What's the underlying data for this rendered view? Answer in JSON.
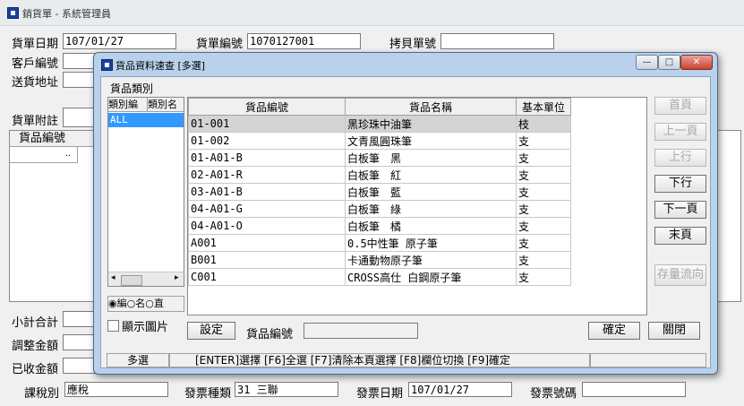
{
  "window": {
    "title": "銷貨單 - 系統管理員"
  },
  "form": {
    "order_date_label": "貨單日期",
    "order_date_value": "107/01/27",
    "order_no_label": "貨單編號",
    "order_no_value": "1070127001",
    "copy_no_label": "拷貝單號",
    "copy_no_value": "",
    "customer_label": "客戶編號",
    "address_label": "送貨地址",
    "note_label": "貨單附註",
    "item_code_header": "貨品編號",
    "subtotal_label": "小計合計",
    "adjust_label": "調整金額",
    "received_label": "已收金額",
    "tax_label": "課稅別",
    "tax_value": "應稅",
    "invoice_type_label": "發票種類",
    "invoice_type_value": "31 三聯",
    "invoice_date_label": "發票日期",
    "invoice_date_value": "107/01/27",
    "invoice_no_label": "發票號碼",
    "invoice_no_value": ""
  },
  "dialog": {
    "title": "貨品資料速查 [多選]",
    "category_label": "貨品類別",
    "category_headers": [
      "類別編",
      "類別名"
    ],
    "categories": [
      {
        "code": "ALL",
        "name": ""
      }
    ],
    "radio_options": [
      "編",
      "名",
      "直"
    ],
    "show_image_label": "顯示圖片",
    "columns": [
      "貨品編號",
      "貨品名稱",
      "基本單位"
    ],
    "rows": [
      {
        "code": "01-001",
        "name": "黑珍珠中油筆",
        "unit": "枝"
      },
      {
        "code": "01-002",
        "name": "文青風圓珠筆",
        "unit": "支"
      },
      {
        "code": "01-A01-B",
        "name": "白板筆　黑",
        "unit": "支"
      },
      {
        "code": "02-A01-R",
        "name": "白板筆　紅",
        "unit": "支"
      },
      {
        "code": "03-A01-B",
        "name": "白板筆　藍",
        "unit": "支"
      },
      {
        "code": "04-A01-G",
        "name": "白板筆　綠",
        "unit": "支"
      },
      {
        "code": "04-A01-O",
        "name": "白板筆　橘",
        "unit": "支"
      },
      {
        "code": "A001",
        "name": "0.5中性筆 原子筆",
        "unit": "支"
      },
      {
        "code": "B001",
        "name": "卡通動物原子筆",
        "unit": "支"
      },
      {
        "code": "C001",
        "name": "CROSS高仕 白鋼原子筆",
        "unit": "支"
      }
    ],
    "nav": {
      "first": "首頁",
      "prev_page": "上一頁",
      "prev_row": "上行",
      "next_row": "下行",
      "next_page": "下一頁",
      "last": "末頁",
      "stock": "存量流向"
    },
    "setting_label": "設定",
    "search_label": "貨品編號",
    "search_value": "",
    "ok_label": "確定",
    "close_label": "關閉",
    "status_mode": "多選",
    "status_hint": "[ENTER]選擇 [F6]全選 [F7]清除本頁選擇 [F8]欄位切換 [F9]確定"
  }
}
